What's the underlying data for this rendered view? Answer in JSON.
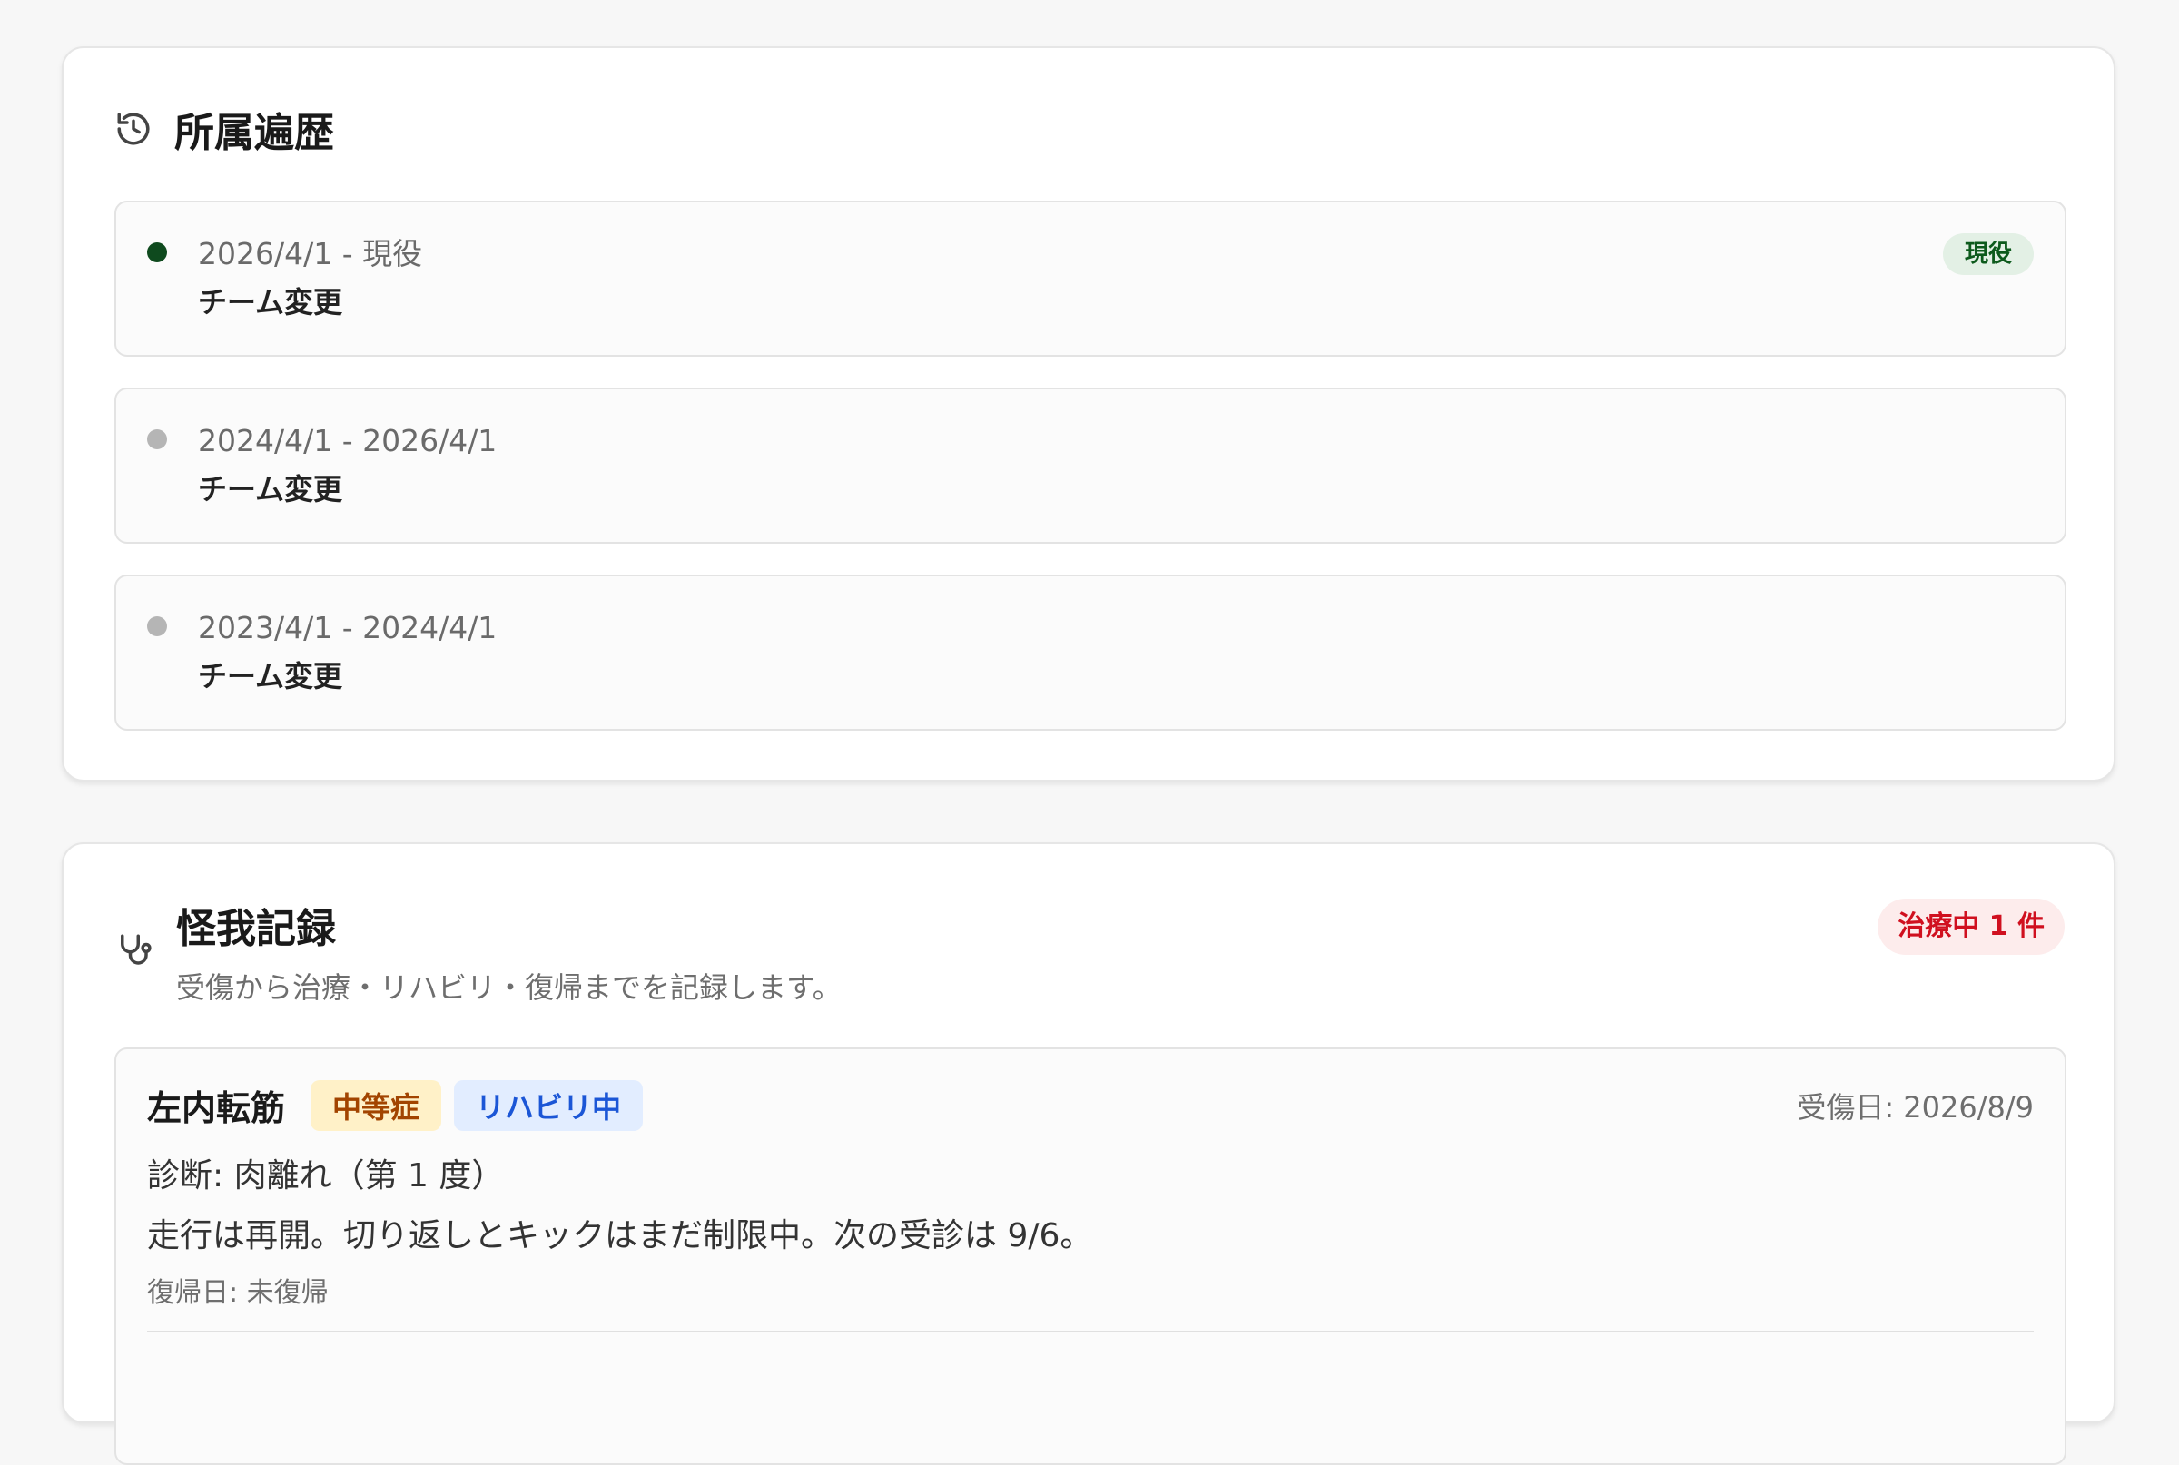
{
  "history": {
    "icon": "history-icon",
    "title": "所属遍歴",
    "items": [
      {
        "period": "2026/4/1 - 現役",
        "reason": "チーム変更",
        "badge": "現役",
        "dot_color": "#0f4a1e"
      },
      {
        "period": "2024/4/1 - 2026/4/1",
        "reason": "チーム変更",
        "dot_color": "#b5b5b5"
      },
      {
        "period": "2023/4/1 - 2024/4/1",
        "reason": "チーム変更",
        "dot_color": "#b5b5b5"
      }
    ]
  },
  "injuries": {
    "icon": "stethoscope-icon",
    "title": "怪我記録",
    "description": "受傷から治療・リハビリ・復帰までを記録します。",
    "status_badge": "治療中 1 件",
    "items": [
      {
        "body_part": "左内転筋",
        "severity": "中等症",
        "status": "リハビリ中",
        "injury_date": "受傷日: 2026/8/9",
        "diagnosis": "診断: 肉離れ（第 1 度）",
        "note": "走行は再開。切り返しとキックはまだ制限中。次の受診は 9/6。",
        "return_date": "復帰日: 未復帰"
      }
    ]
  },
  "colors": {
    "current_badge_text": "#0d5a1c",
    "treatment_badge_text": "#d0101f",
    "severity_tag_text": "#a24400",
    "status_tag_text": "#1b56d6"
  }
}
